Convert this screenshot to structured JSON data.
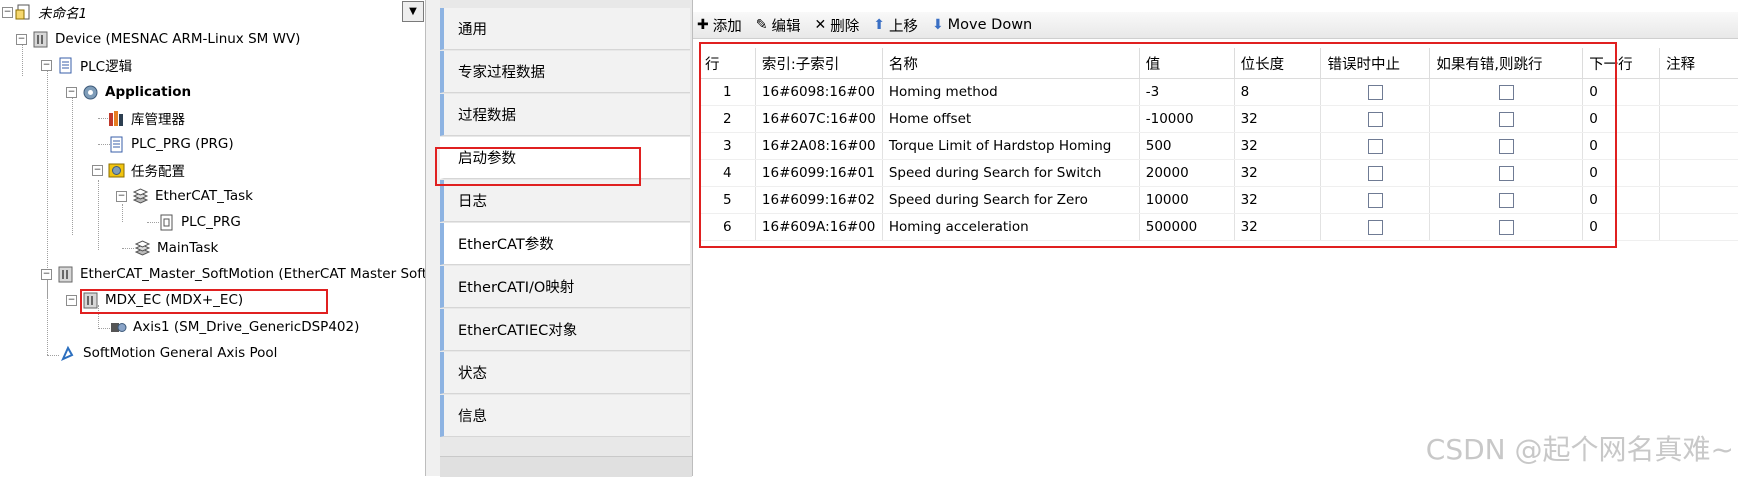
{
  "tree": {
    "project": "未命名1",
    "device": "Device (MESNAC ARM-Linux SM WV)",
    "plc_logic": "PLC逻辑",
    "application": "Application",
    "library_manager": "库管理器",
    "plc_prg_prg": "PLC_PRG (PRG)",
    "task_config": "任务配置",
    "ethercat_task": "EtherCAT_Task",
    "plc_prg": "PLC_PRG",
    "main_task": "MainTask",
    "ethercat_master": "EtherCAT_Master_SoftMotion (EtherCAT Master SoftMotion)",
    "mdx_ec": "MDX_EC (MDX+_EC)",
    "axis1": "Axis1 (SM_Drive_GenericDSP402)",
    "axis_pool": "SoftMotion General Axis Pool"
  },
  "tabs": [
    {
      "label": "通用"
    },
    {
      "label": "专家过程数据"
    },
    {
      "label": "过程数据"
    },
    {
      "label": "启动参数"
    },
    {
      "label": "日志"
    },
    {
      "label": "EtherCAT参数"
    },
    {
      "label": "EtherCATI/O映射"
    },
    {
      "label": "EtherCATIEC对象"
    },
    {
      "label": "状态"
    },
    {
      "label": "信息"
    }
  ],
  "toolbar": {
    "add": "添加",
    "edit": "编辑",
    "delete": "删除",
    "move_up": "上移",
    "move_down": "Move Down"
  },
  "table": {
    "headers": {
      "row": "行",
      "index": "索引:子索引",
      "name": "名称",
      "value": "值",
      "bitlen": "位长度",
      "abort": "错误时中止",
      "jump": "如果有错,则跳行",
      "next": "下一行",
      "comment": "注释"
    },
    "rows": [
      {
        "row": "1",
        "index": "16#6098:16#00",
        "name": "Homing method",
        "value": "-3",
        "bitlen": "8",
        "next": "0",
        "abort": false,
        "jump": false
      },
      {
        "row": "2",
        "index": "16#607C:16#00",
        "name": "Home offset",
        "value": "-10000",
        "bitlen": "32",
        "next": "0",
        "abort": false,
        "jump": false
      },
      {
        "row": "3",
        "index": "16#2A08:16#00",
        "name": "Torque Limit of Hardstop Homing",
        "value": "500",
        "bitlen": "32",
        "next": "0",
        "abort": false,
        "jump": false
      },
      {
        "row": "4",
        "index": "16#6099:16#01",
        "name": "Speed during Search for Switch",
        "value": "20000",
        "bitlen": "32",
        "next": "0",
        "abort": false,
        "jump": false
      },
      {
        "row": "5",
        "index": "16#6099:16#02",
        "name": "Speed during Search for Zero",
        "value": "10000",
        "bitlen": "32",
        "next": "0",
        "abort": false,
        "jump": false
      },
      {
        "row": "6",
        "index": "16#609A:16#00",
        "name": "Homing acceleration",
        "value": "500000",
        "bitlen": "32",
        "next": "0",
        "abort": false,
        "jump": false
      }
    ]
  },
  "watermark": "CSDN @起个网名真难~"
}
